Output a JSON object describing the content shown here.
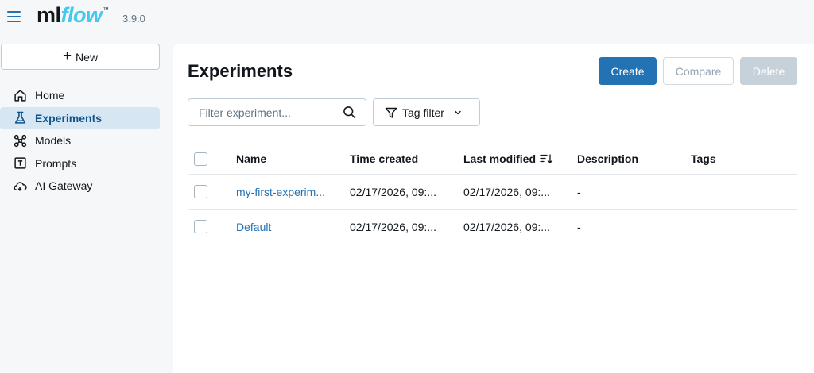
{
  "app": {
    "version": "3.9.0",
    "logo_ml": "ml",
    "logo_flow": "flow",
    "logo_tm": "™"
  },
  "sidebar": {
    "new_label": "New",
    "items": [
      {
        "label": "Home",
        "icon": "home-icon",
        "active": false
      },
      {
        "label": "Experiments",
        "icon": "beaker-icon",
        "active": true
      },
      {
        "label": "Models",
        "icon": "models-icon",
        "active": false
      },
      {
        "label": "Prompts",
        "icon": "prompts-icon",
        "active": false
      },
      {
        "label": "AI Gateway",
        "icon": "cloud-gateway-icon",
        "active": false
      }
    ]
  },
  "main": {
    "title": "Experiments",
    "buttons": {
      "create": "Create",
      "compare": "Compare",
      "delete": "Delete"
    },
    "search": {
      "placeholder": "Filter experiment...",
      "value": ""
    },
    "tag_filter_label": "Tag filter",
    "table": {
      "columns": {
        "name": "Name",
        "time_created": "Time created",
        "last_modified": "Last modified",
        "description": "Description",
        "tags": "Tags"
      },
      "rows": [
        {
          "name": "my-first-experim...",
          "time_created": "02/17/2026, 09:...",
          "last_modified": "02/17/2026, 09:...",
          "description": "-",
          "tags": ""
        },
        {
          "name": "Default",
          "time_created": "02/17/2026, 09:...",
          "last_modified": "02/17/2026, 09:...",
          "description": "-",
          "tags": ""
        }
      ]
    }
  },
  "colors": {
    "accent": "#2272b4",
    "logo_flow": "#43c9ed",
    "active_nav_bg": "#d7e6f3",
    "disabled_button": "#c7d1da"
  }
}
